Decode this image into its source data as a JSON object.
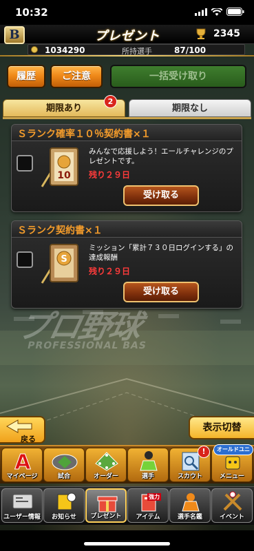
{
  "status_bar": {
    "time": "10:32"
  },
  "header": {
    "logo_letter": "B",
    "title": "プレゼント",
    "points": "2345"
  },
  "info": {
    "money": "1034290",
    "owned_label": "所持選手",
    "owned": "87/100"
  },
  "actions": {
    "history": "履歴",
    "caution": "ご注意",
    "receive_all": "一括受け取り"
  },
  "tabs": [
    {
      "label": "期限あり",
      "badge": "2"
    },
    {
      "label": "期限なし"
    }
  ],
  "presents": [
    {
      "title": "Ｓランク確率１０％契約書×１",
      "description": "みんなで応援しよう！エールチャレンジのプレゼントです。",
      "remaining": "残り２９日",
      "button": "受け取る",
      "thumb_text": "10"
    },
    {
      "title": "Ｓランク契約書×１",
      "description": "ミッション「累計７３０日ログインする」の達成報酬",
      "remaining": "残り２９日",
      "button": "受け取る",
      "thumb_text": "S"
    }
  ],
  "background": {
    "brand": "プロ野球",
    "brand_sub": "PROFESSIONAL BAS"
  },
  "controls": {
    "back": "戻る",
    "toggle": "表示切替"
  },
  "nav_main": [
    {
      "label": "マイページ",
      "icon": "mypage-icon"
    },
    {
      "label": "試合",
      "icon": "stadium-icon"
    },
    {
      "label": "オーダー",
      "icon": "order-icon"
    },
    {
      "label": "選手",
      "icon": "player-icon"
    },
    {
      "label": "スカウト",
      "icon": "scout-icon",
      "alert": "!"
    },
    {
      "label": "メニュー",
      "icon": "menu-icon",
      "tag": "オールドユニ"
    }
  ],
  "nav_sub": [
    {
      "label": "ユーザー情報",
      "icon": "user-info-icon"
    },
    {
      "label": "お知らせ",
      "icon": "news-icon"
    },
    {
      "label": "プレゼント",
      "icon": "present-icon"
    },
    {
      "label": "アイテム",
      "icon": "item-icon",
      "tag": "強力"
    },
    {
      "label": "選手名鑑",
      "icon": "player-book-icon"
    },
    {
      "label": "イベント",
      "icon": "event-icon"
    }
  ],
  "colors": {
    "accent": "#f29b2b",
    "remaining": "#ff3b3b",
    "gold": "#e3b95a"
  }
}
